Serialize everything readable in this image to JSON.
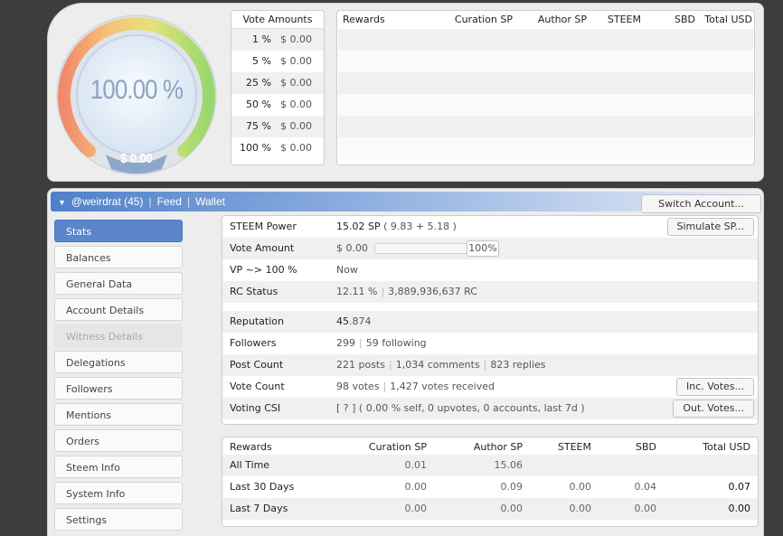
{
  "gauge": {
    "percent": "100.00 %",
    "usd": "$ 0.00",
    "level": 1.0
  },
  "vote_amounts": {
    "title": "Vote Amounts",
    "rows": [
      {
        "pct": "1 %",
        "amt": "$ 0.00"
      },
      {
        "pct": "5 %",
        "amt": "$ 0.00"
      },
      {
        "pct": "25 %",
        "amt": "$ 0.00"
      },
      {
        "pct": "50 %",
        "amt": "$ 0.00"
      },
      {
        "pct": "75 %",
        "amt": "$ 0.00"
      },
      {
        "pct": "100 %",
        "amt": "$ 0.00"
      }
    ]
  },
  "top_rewards": {
    "headers": [
      "Rewards",
      "Curation SP",
      "Author SP",
      "STEEM",
      "SBD",
      "Total USD"
    ]
  },
  "nav": {
    "user": "@weirdrat (45)",
    "feed": "Feed",
    "wallet": "Wallet",
    "switch": "Switch Account..."
  },
  "menu": {
    "stats": "Stats",
    "balances": "Balances",
    "general_data": "General Data",
    "account_details": "Account Details",
    "witness_details": "Witness Details",
    "delegations": "Delegations",
    "followers": "Followers",
    "mentions": "Mentions",
    "orders": "Orders",
    "steem_info": "Steem Info",
    "system_info": "System Info",
    "settings": "Settings"
  },
  "stats": {
    "steem_power": {
      "label": "STEEM Power",
      "value": "15.02 SP",
      "detail": "( 9.83 + 5.18 )",
      "button": "Simulate SP..."
    },
    "vote_amount": {
      "label": "Vote Amount",
      "value": "$ 0.00",
      "slider_pct": "100%",
      "level": 1.0
    },
    "vp": {
      "label": "VP ~> 100 %",
      "value": "Now"
    },
    "rc": {
      "label": "RC Status",
      "pct": "12.11 %",
      "rc": "3,889,936,637 RC"
    },
    "reputation": {
      "label": "Reputation",
      "main": "45",
      "dec": ".874"
    },
    "followers": {
      "label": "Followers",
      "count": "299",
      "following": "59 following"
    },
    "post_count": {
      "label": "Post Count",
      "posts": "221 posts",
      "comments": "1,034 comments",
      "replies": "823 replies"
    },
    "vote_count": {
      "label": "Vote Count",
      "votes": "98 votes",
      "received": "1,427 votes received",
      "button": "Inc. Votes..."
    },
    "voting_csi": {
      "label": "Voting CSI",
      "value": "[ ? ] ( 0.00 % self, 0 upvotes, 0 accounts, last 7d )",
      "button": "Out. Votes..."
    }
  },
  "rewards": {
    "headers": [
      "Rewards",
      "Curation SP",
      "Author SP",
      "STEEM",
      "SBD",
      "Total USD"
    ],
    "rows": [
      {
        "label": "All Time",
        "curation": "0.01",
        "author": "15.06",
        "steem": "",
        "sbd": "",
        "total": ""
      },
      {
        "label": "Last 30 Days",
        "curation": "0.00",
        "author": "0.09",
        "steem": "0.00",
        "sbd": "0.04",
        "total": "0.07"
      },
      {
        "label": "Last 7 Days",
        "curation": "0.00",
        "author": "0.00",
        "steem": "0.00",
        "sbd": "0.00",
        "total": "0.00"
      }
    ]
  }
}
